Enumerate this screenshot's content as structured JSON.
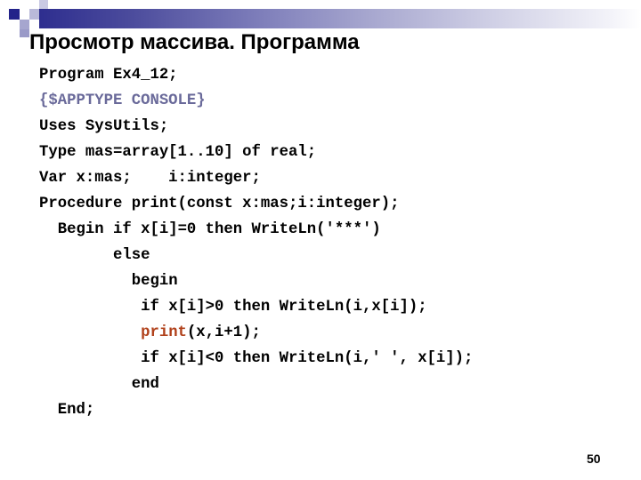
{
  "slide": {
    "title": "Просмотр массива. Программа",
    "page_number": "50",
    "colors": {
      "accent_dark": "#2e2e8f",
      "directive": "#6a6a9a",
      "recursive_call": "#b0401a"
    }
  },
  "code": {
    "lines": [
      {
        "indent": "",
        "text": "Program Ex4_12;"
      },
      {
        "indent": "",
        "text": "{$APPTYPE CONSOLE}"
      },
      {
        "indent": "",
        "text": "Uses SysUtils;"
      },
      {
        "indent": "",
        "text": "Type mas=array[1..10] of real;"
      },
      {
        "indent": "",
        "text": "Var x:mas;    i:integer;"
      },
      {
        "indent": "",
        "text": "Procedure print(const x:mas;i:integer);"
      },
      {
        "indent": "  ",
        "text": "Begin if x[i]=0 then WriteLn('***')"
      },
      {
        "indent": "        ",
        "text": "else"
      },
      {
        "indent": "          ",
        "text": "begin"
      },
      {
        "indent": "           ",
        "text": "if x[i]>0 then WriteLn(i,x[i]);"
      },
      {
        "indent": "           ",
        "call": "print",
        "text": "(x,i+1);"
      },
      {
        "indent": "           ",
        "text": "if x[i]<0 then WriteLn(i,' ', x[i]);"
      },
      {
        "indent": "          ",
        "text": "end"
      },
      {
        "indent": "  ",
        "text": "End;"
      }
    ]
  }
}
